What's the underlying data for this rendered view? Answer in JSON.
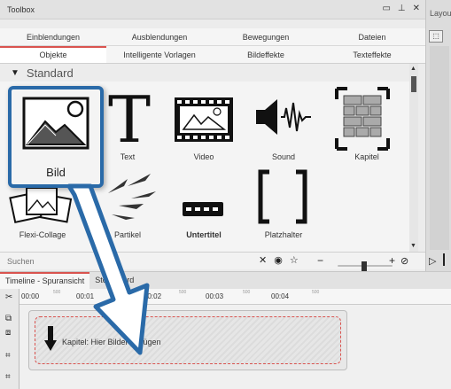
{
  "toolbox": {
    "title": "Toolbox",
    "tabs_row1": [
      "Einblendungen",
      "Ausblendungen",
      "Bewegungen",
      "Dateien"
    ],
    "tabs_row2": [
      "Objekte",
      "Intelligente Vorlagen",
      "Bildeffekte",
      "Texteffekte"
    ],
    "active_tab": "Objekte",
    "section": "Standard",
    "items": [
      {
        "label": "Bild",
        "icon": "picture-icon",
        "selected": true
      },
      {
        "label": "Text",
        "icon": "text-T-icon"
      },
      {
        "label": "Video",
        "icon": "video-film-icon"
      },
      {
        "label": "Sound",
        "icon": "speaker-icon"
      },
      {
        "label": "Kapitel",
        "icon": "chapter-icon"
      },
      {
        "label": "Flexi-Collage",
        "icon": "collage-icon"
      },
      {
        "label": "Partikel",
        "icon": "particle-icon"
      },
      {
        "label": "Untertitel",
        "icon": "subtitle-icon"
      },
      {
        "label": "Platzhalter",
        "icon": "placeholder-bracket-icon"
      }
    ],
    "search_placeholder": "Suchen"
  },
  "layout_panel": {
    "title": "Layou"
  },
  "timeline": {
    "tabs": [
      "Timeline - Spuransicht",
      "Storyboard"
    ],
    "time_labels": [
      "00:00",
      "00:01",
      "00:02",
      "00:03",
      "00:04"
    ],
    "minor_label": "500",
    "drop_text": "Kapitel: Hier Bilder einfügen"
  },
  "colors": {
    "accent": "#2a6aa8",
    "tab_highlight": "#d9534f"
  }
}
